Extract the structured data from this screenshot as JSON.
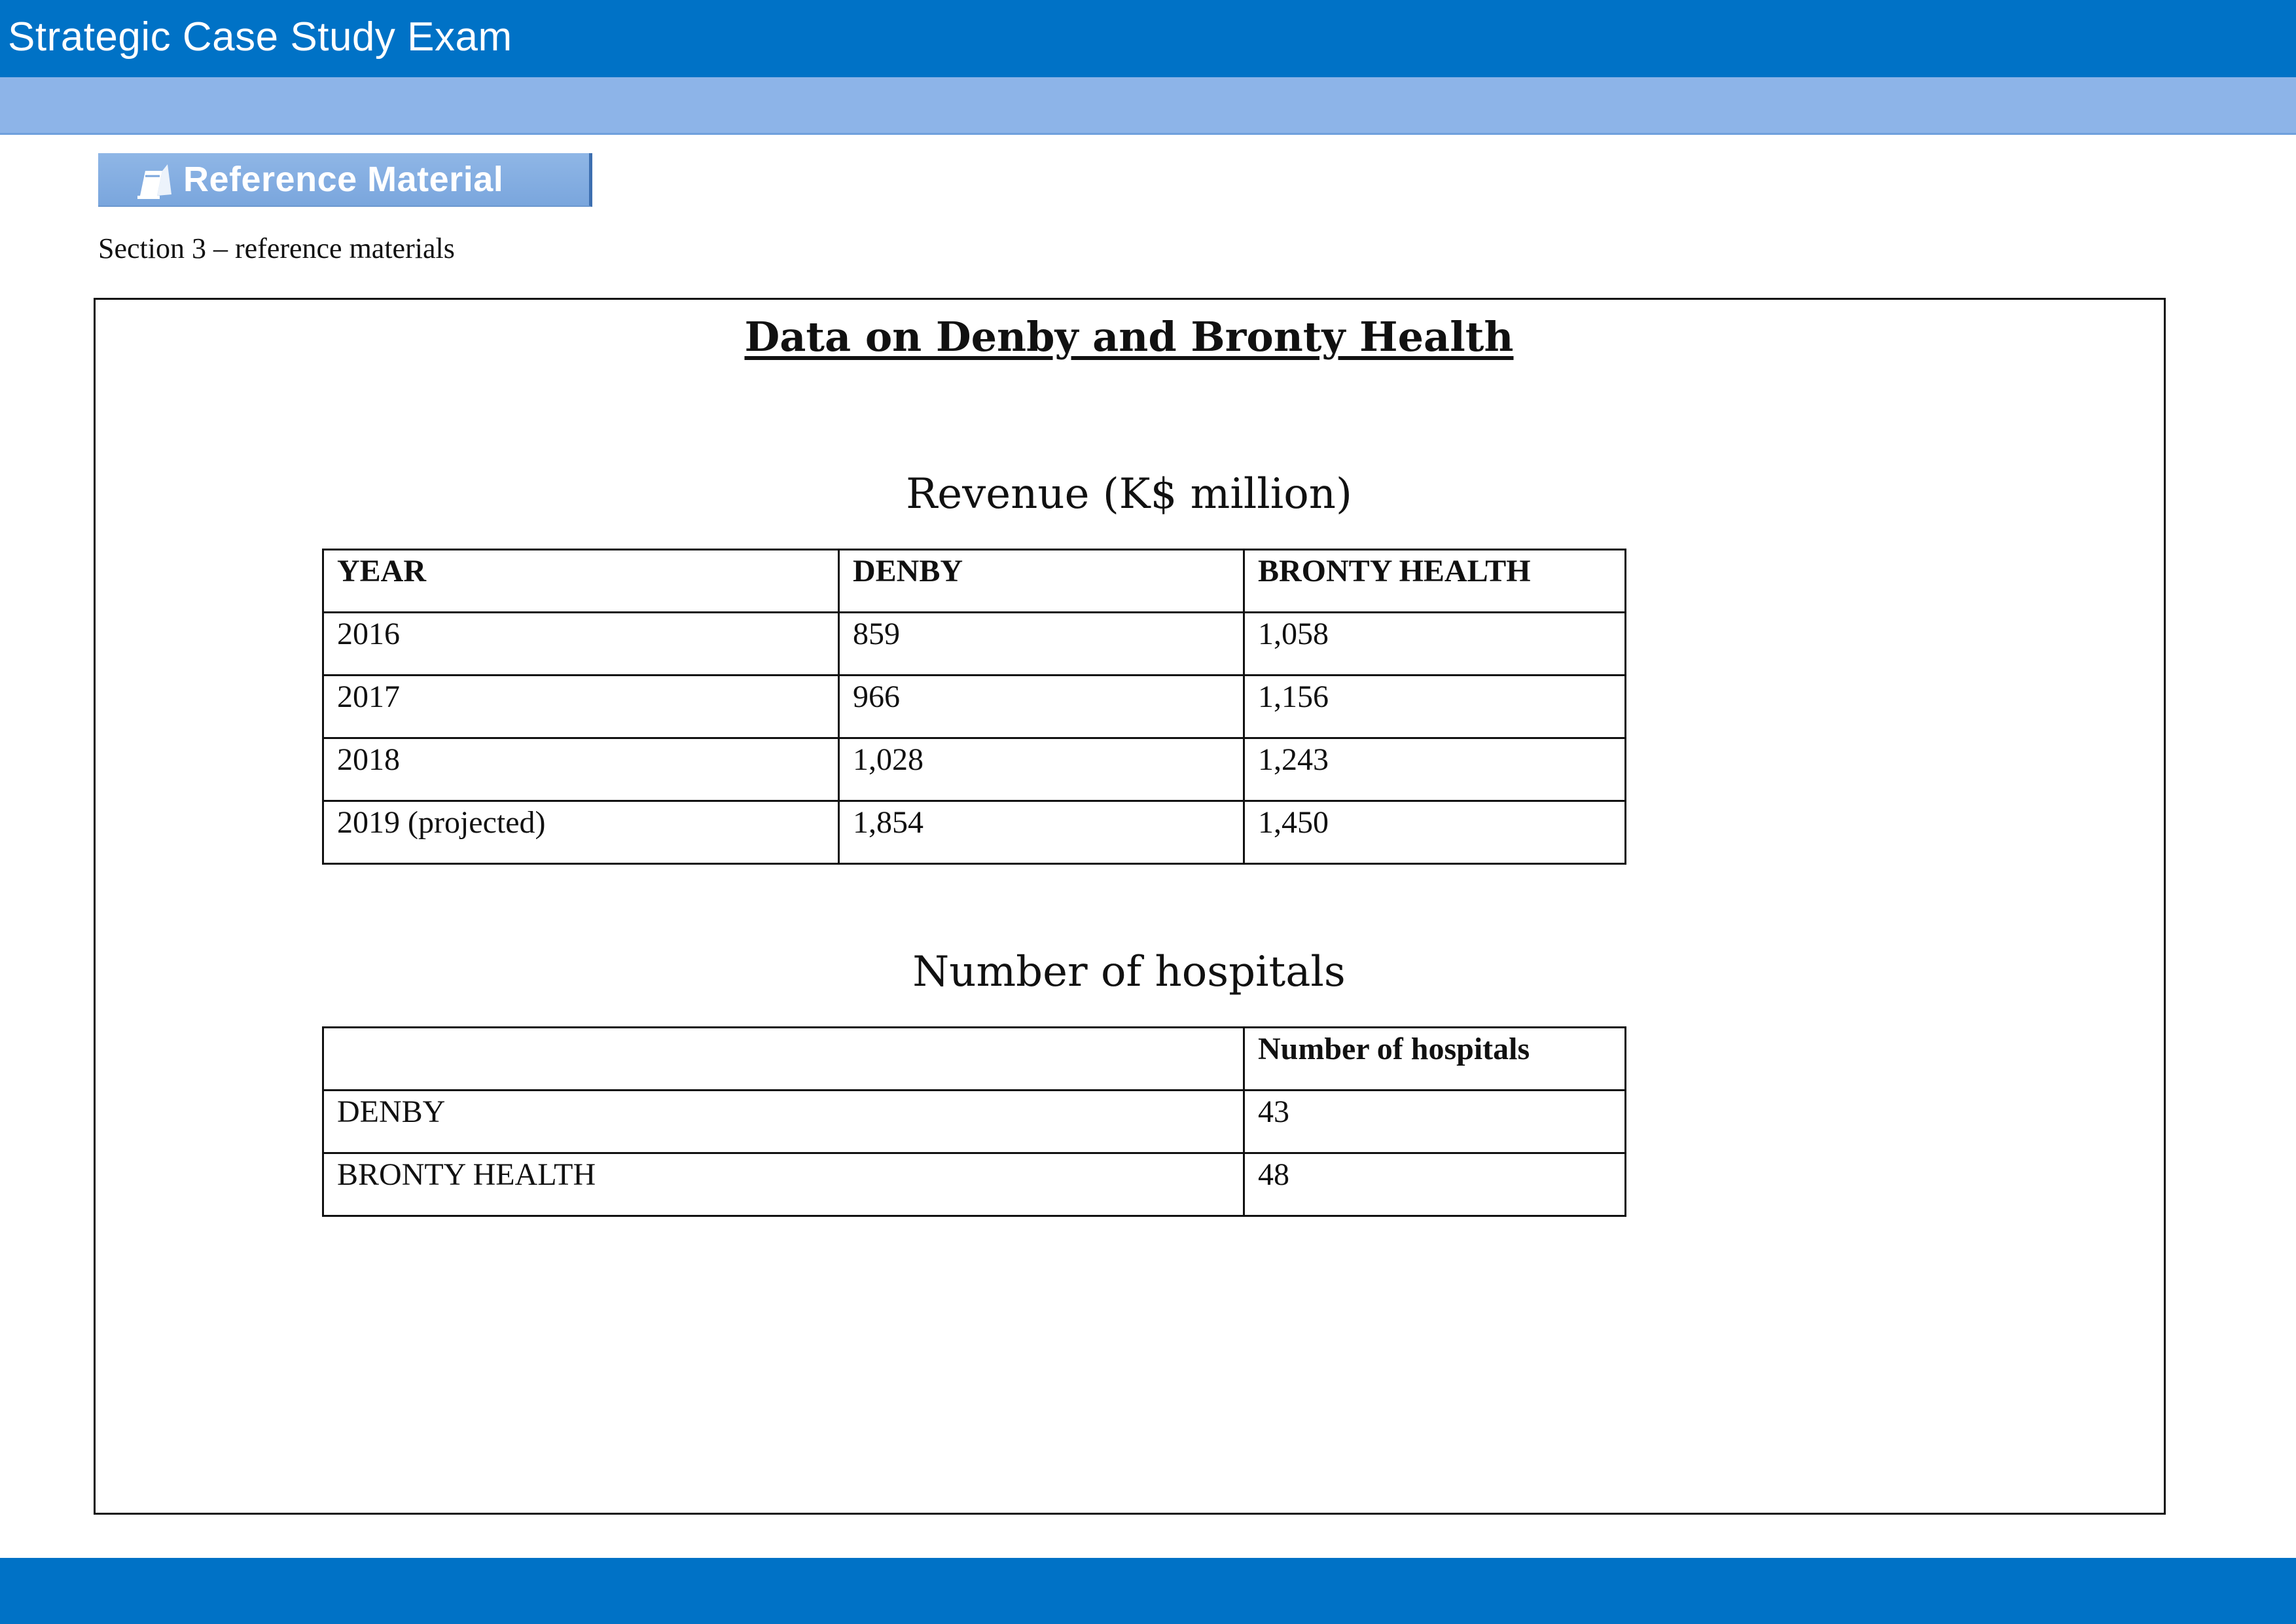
{
  "header": {
    "title": "Strategic Case Study Exam"
  },
  "toolbar": {
    "reference_button_label": "Reference Material",
    "reference_icon": "reference-book-icon"
  },
  "section": {
    "label": "Section 3 – reference materials"
  },
  "document": {
    "title": "Data on Denby and Bronty Health",
    "revenue_table": {
      "caption": "Revenue (K$ million)",
      "headers": [
        "YEAR",
        "DENBY",
        "BRONTY HEALTH"
      ],
      "rows": [
        [
          "2016",
          "859",
          "1,058"
        ],
        [
          "2017",
          "966",
          "1,156"
        ],
        [
          "2018",
          "1,028",
          "1,243"
        ],
        [
          "2019 (projected)",
          "1,854",
          "1,450"
        ]
      ]
    },
    "hospitals_table": {
      "caption": "Number of hospitals",
      "headers": [
        "",
        "Number of hospitals"
      ],
      "rows": [
        [
          "DENBY",
          "43"
        ],
        [
          "BRONTY HEALTH",
          "48"
        ]
      ]
    }
  },
  "colors": {
    "header_bar": "#0072c6",
    "sub_bar": "#8db4e8",
    "reference_button": "#7aa6dd"
  }
}
